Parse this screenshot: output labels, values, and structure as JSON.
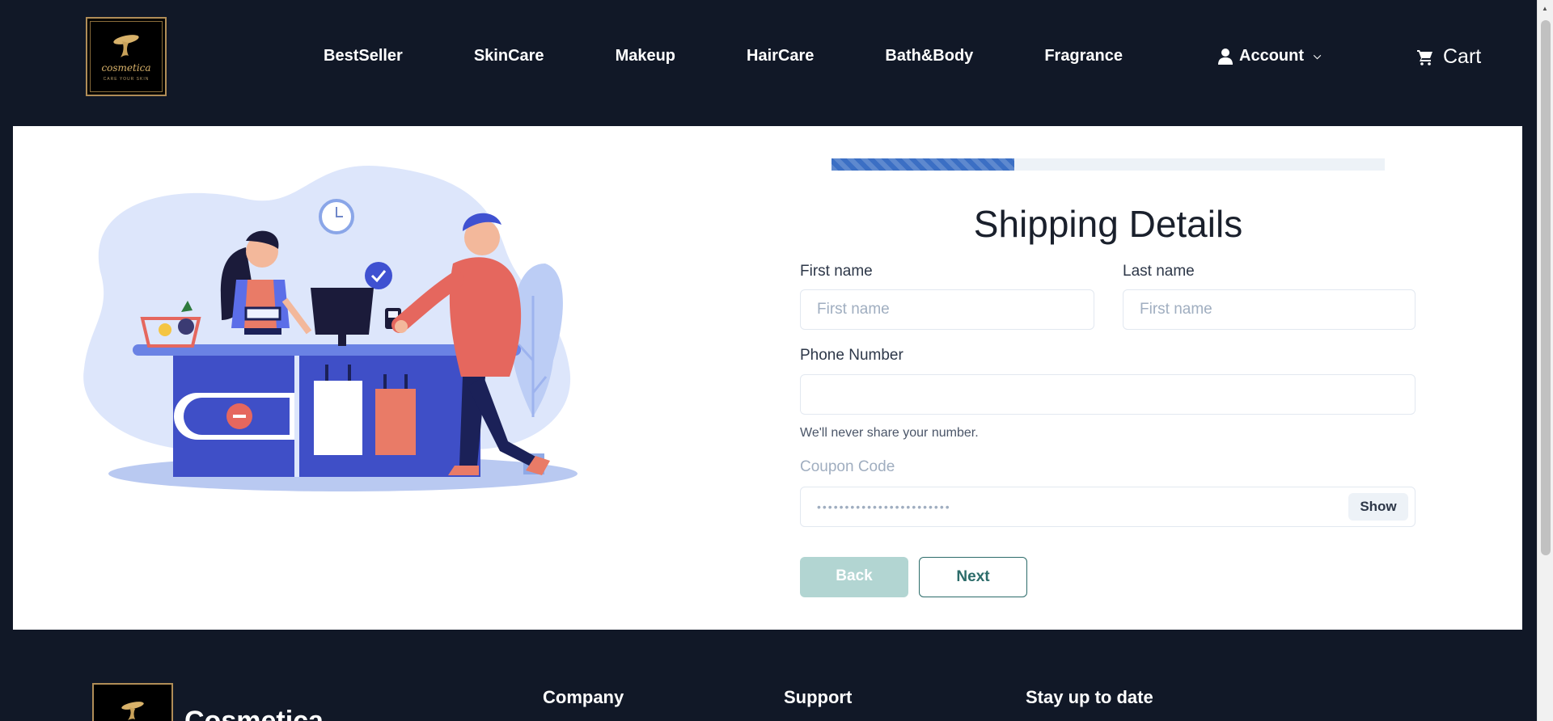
{
  "header": {
    "logo": {
      "text": "cosmetica",
      "tagline": "CARE YOUR SKIN"
    },
    "nav": [
      "BestSeller",
      "SkinCare",
      "Makeup",
      "HairCare",
      "Bath&Body",
      "Fragrance"
    ],
    "account_label": "Account",
    "cart_label": "Cart"
  },
  "form": {
    "progress": 0.33,
    "title": "Shipping Details",
    "first_name": {
      "label": "First name",
      "placeholder": "First name",
      "value": ""
    },
    "last_name": {
      "label": "Last name",
      "placeholder": "First name",
      "value": ""
    },
    "phone": {
      "label": "Phone Number",
      "value": "",
      "helper": "We'll never share your number."
    },
    "coupon": {
      "label": "Coupon Code",
      "masked_value": "••••••••••••••••••••••••",
      "show_label": "Show"
    },
    "back_label": "Back",
    "next_label": "Next"
  },
  "footer": {
    "brand": "Cosmetica",
    "headings": [
      "Company",
      "Support",
      "Stay up to date"
    ]
  },
  "colors": {
    "header_bg": "#111827",
    "progress_fill": "#3b6fc4",
    "back_button": "#b2d5d2",
    "next_border": "#2c6c6a"
  }
}
